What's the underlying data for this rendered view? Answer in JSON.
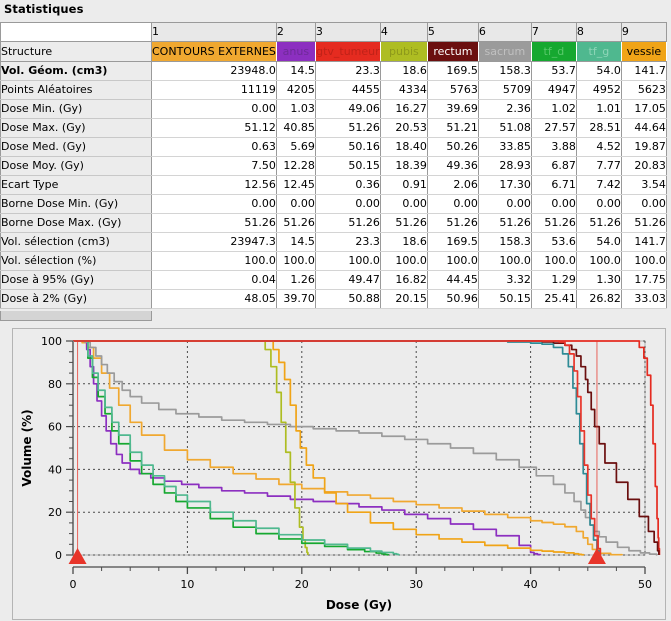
{
  "panel": {
    "title": "Statistiques"
  },
  "table": {
    "column_numbers": [
      "1",
      "2",
      "3",
      "4",
      "5",
      "6",
      "7",
      "8",
      "9"
    ],
    "row_header_label": "Structure",
    "structures": [
      {
        "name": "CONTOURS EXTERNES",
        "color": "#f0a830",
        "text_color": "#000000"
      },
      {
        "name": "anus",
        "color": "#8c2fc0",
        "text_color": "#6f2a99"
      },
      {
        "name": "gtv_tumeur",
        "color": "#e52b20",
        "text_color": "#c02218"
      },
      {
        "name": "pubis",
        "color": "#aebd22",
        "text_color": "#8d991b"
      },
      {
        "name": "rectum",
        "color": "#6b0f0f",
        "text_color": "#ffffff"
      },
      {
        "name": "sacrum",
        "color": "#9b9b9b",
        "text_color": "#c0c0c0"
      },
      {
        "name": "tf_d",
        "color": "#16a830",
        "text_color": "#59c96b"
      },
      {
        "name": "tf_g",
        "color": "#4fb88f",
        "text_color": "#8fd5b8"
      },
      {
        "name": "vessie",
        "color": "#f0a417",
        "text_color": "#000000"
      }
    ],
    "rows": [
      {
        "label": "Vol. Géom. (cm3)",
        "bold": true,
        "values": [
          "23948.0",
          "14.5",
          "23.3",
          "18.6",
          "169.5",
          "158.3",
          "53.7",
          "54.0",
          "141.7"
        ]
      },
      {
        "label": "Points Aléatoires",
        "bold": false,
        "values": [
          "11119",
          "4205",
          "4455",
          "4334",
          "5763",
          "5709",
          "4947",
          "4952",
          "5623"
        ]
      },
      {
        "label": "Dose Min. (Gy)",
        "bold": false,
        "values": [
          "0.00",
          "1.03",
          "49.06",
          "16.27",
          "39.69",
          "2.36",
          "1.02",
          "1.01",
          "17.05"
        ]
      },
      {
        "label": "Dose Max. (Gy)",
        "bold": false,
        "values": [
          "51.12",
          "40.85",
          "51.26",
          "20.53",
          "51.21",
          "51.08",
          "27.57",
          "28.51",
          "44.64"
        ]
      },
      {
        "label": "Dose Med. (Gy)",
        "bold": false,
        "values": [
          "0.63",
          "5.69",
          "50.16",
          "18.40",
          "50.26",
          "33.85",
          "3.88",
          "4.52",
          "19.87"
        ]
      },
      {
        "label": "Dose Moy. (Gy)",
        "bold": false,
        "values": [
          "7.50",
          "12.28",
          "50.15",
          "18.39",
          "49.36",
          "28.93",
          "6.87",
          "7.77",
          "20.83"
        ]
      },
      {
        "label": "Ecart Type",
        "bold": false,
        "values": [
          "12.56",
          "12.45",
          "0.36",
          "0.91",
          "2.06",
          "17.30",
          "6.71",
          "7.42",
          "3.54"
        ]
      },
      {
        "label": "Borne Dose Min. (Gy)",
        "bold": false,
        "values": [
          "0.00",
          "0.00",
          "0.00",
          "0.00",
          "0.00",
          "0.00",
          "0.00",
          "0.00",
          "0.00"
        ]
      },
      {
        "label": "Borne Dose Max. (Gy)",
        "bold": false,
        "values": [
          "51.26",
          "51.26",
          "51.26",
          "51.26",
          "51.26",
          "51.26",
          "51.26",
          "51.26",
          "51.26"
        ]
      },
      {
        "label": "Vol. sélection (cm3)",
        "bold": false,
        "values": [
          "23947.3",
          "14.5",
          "23.3",
          "18.6",
          "169.5",
          "158.3",
          "53.6",
          "54.0",
          "141.7"
        ]
      },
      {
        "label": "Vol. sélection (%)",
        "bold": false,
        "values": [
          "100.0",
          "100.0",
          "100.0",
          "100.0",
          "100.0",
          "100.0",
          "100.0",
          "100.0",
          "100.0"
        ]
      },
      {
        "label": "Dose à 95% (Gy)",
        "bold": false,
        "values": [
          "0.04",
          "1.26",
          "49.47",
          "16.82",
          "44.45",
          "3.32",
          "1.29",
          "1.30",
          "17.75"
        ]
      },
      {
        "label": "Dose à 2% (Gy)",
        "bold": false,
        "values": [
          "48.05",
          "39.70",
          "50.88",
          "20.15",
          "50.96",
          "50.15",
          "25.41",
          "26.82",
          "33.03"
        ]
      }
    ]
  },
  "chart_data": {
    "type": "line",
    "title": "",
    "xlabel": "Dose (Gy)",
    "ylabel": "Volume (%)",
    "xlim": [
      0,
      50
    ],
    "ylim": [
      0,
      100
    ],
    "xticks": [
      0,
      10,
      20,
      30,
      40,
      50
    ],
    "yticks": [
      0,
      20,
      40,
      60,
      80,
      100
    ],
    "grid": true,
    "legend": "none",
    "markers": [
      {
        "name": "cursor-min",
        "x": 0.4,
        "color": "#e8352a"
      },
      {
        "name": "cursor-max",
        "x": 45.8,
        "color": "#e8352a"
      }
    ],
    "series": [
      {
        "name": "CONTOURS EXTERNES",
        "color": "#f0a830",
        "x": [
          0,
          0.4,
          0.8,
          1.2,
          1.8,
          2.5,
          3.2,
          4,
          5,
          6,
          8,
          10,
          12,
          14,
          16,
          18,
          20,
          22,
          24,
          26,
          28,
          30,
          32,
          34,
          36,
          38,
          40,
          41,
          42,
          43,
          44,
          44.6,
          45,
          45.4,
          46,
          47,
          48
        ],
        "y": [
          100,
          100,
          99.2,
          97,
          92,
          85,
          78,
          70,
          62,
          56,
          49,
          44.5,
          41,
          38,
          35.5,
          33,
          31,
          29.5,
          28,
          26.5,
          25,
          23.5,
          22,
          20.5,
          19,
          17.5,
          16,
          15.2,
          14.4,
          13.2,
          11,
          8,
          5,
          2.6,
          0.8,
          0.15,
          0
        ]
      },
      {
        "name": "anus",
        "color": "#8c2fc0",
        "x": [
          0,
          1,
          1.2,
          1.5,
          1.8,
          2.1,
          2.5,
          2.9,
          3.3,
          3.8,
          4.3,
          5,
          5.8,
          6.8,
          8,
          9.5,
          11,
          13,
          15,
          17,
          19,
          21,
          23,
          25,
          27,
          29,
          31,
          33,
          35,
          37,
          39,
          40,
          40.3,
          40.6,
          40.85
        ],
        "y": [
          100,
          100,
          96,
          88,
          80,
          72,
          65,
          58,
          52,
          47,
          43,
          40,
          38,
          36,
          34.5,
          33,
          31.5,
          30,
          29,
          27.5,
          26,
          25,
          24,
          22.5,
          21,
          19,
          17,
          14.5,
          12,
          9,
          4.5,
          1.2,
          0.6,
          0.2,
          0
        ]
      },
      {
        "name": "gtv_tumeur",
        "color": "#e52b20",
        "x": [
          0,
          10,
          20,
          30,
          40,
          45,
          47,
          48.5,
          49.06,
          49.5,
          49.9,
          50.2,
          50.5,
          50.7,
          50.9,
          51.05,
          51.15,
          51.2,
          51.26
        ],
        "y": [
          100,
          100,
          100,
          100,
          100,
          100,
          100,
          100,
          100,
          97,
          92,
          84,
          70,
          52,
          32,
          17,
          8,
          3,
          0
        ]
      },
      {
        "name": "pubis",
        "color": "#aebd22",
        "x": [
          0,
          5,
          10,
          14,
          16,
          16.27,
          16.8,
          17.3,
          17.8,
          18.2,
          18.6,
          19,
          19.4,
          19.8,
          20.1,
          20.3,
          20.45,
          20.53
        ],
        "y": [
          100,
          100,
          100,
          100,
          100,
          100,
          96,
          88,
          76,
          62,
          48,
          34,
          22,
          13,
          7,
          3.5,
          1.2,
          0
        ]
      },
      {
        "name": "rectum",
        "color": "#6b0f0f",
        "x": [
          0,
          10,
          20,
          30,
          35,
          39.69,
          41,
          42,
          43,
          43.6,
          44,
          44.4,
          44.8,
          45,
          45.3,
          45.6,
          46,
          46.5,
          47.5,
          48.5,
          49.5,
          50.3,
          50.8,
          51.1,
          51.21
        ],
        "y": [
          100,
          100,
          100,
          100,
          100,
          100,
          99.6,
          99,
          98,
          96,
          93,
          88,
          82,
          76,
          68,
          60,
          52,
          43,
          34,
          26,
          18,
          11,
          6,
          2,
          0
        ]
      },
      {
        "name": "sacrum",
        "color": "#9b9b9b",
        "x": [
          0,
          1,
          1.5,
          2,
          2.5,
          3,
          3.6,
          4.3,
          5,
          6,
          7.5,
          9,
          11,
          13,
          15,
          17,
          19,
          21,
          23,
          25,
          27,
          29,
          31,
          33,
          35,
          37,
          39,
          40.5,
          42,
          43,
          43.8,
          44.4,
          44.8,
          45.2,
          45.6,
          46,
          46.6,
          47.6,
          48.6,
          49.6,
          50.4,
          51,
          51.08
        ],
        "y": [
          100,
          99.5,
          97,
          93,
          89,
          85,
          81,
          77,
          74,
          71,
          68,
          66,
          64.5,
          63,
          62,
          61,
          60,
          59,
          58,
          57,
          55.5,
          54,
          52,
          50,
          47.5,
          44.5,
          41,
          37,
          33,
          29,
          25,
          21,
          17.5,
          14,
          11,
          8.5,
          6,
          3.6,
          2,
          1,
          0.4,
          0.1,
          0
        ]
      },
      {
        "name": "tf_d",
        "color": "#16a830",
        "x": [
          0,
          1.02,
          1.3,
          1.7,
          2.2,
          2.8,
          3.4,
          4,
          5,
          6,
          7,
          8,
          9,
          10,
          12,
          14,
          16,
          18,
          20,
          22,
          24,
          25.5,
          26.5,
          27,
          27.3,
          27.45,
          27.57
        ],
        "y": [
          100,
          100,
          92,
          83,
          74,
          66,
          58,
          52,
          44,
          38,
          33,
          29,
          25,
          22,
          17,
          13,
          10,
          7.5,
          5.5,
          4,
          2.5,
          1.6,
          0.9,
          0.5,
          0.25,
          0.1,
          0
        ]
      },
      {
        "name": "tf_g",
        "color": "#4fb88f",
        "x": [
          0,
          1.01,
          1.3,
          1.7,
          2.2,
          2.8,
          3.4,
          4,
          5,
          6,
          7,
          8,
          9,
          10,
          12,
          14,
          16,
          18,
          20,
          22,
          24,
          26,
          27,
          28,
          28.3,
          28.45,
          28.51
        ],
        "y": [
          100,
          100,
          93,
          85,
          77,
          69,
          62,
          56,
          48,
          42,
          37,
          32,
          28,
          25,
          20,
          16,
          12.5,
          9.5,
          7,
          5,
          3.2,
          1.8,
          1.2,
          0.6,
          0.3,
          0.1,
          0
        ]
      },
      {
        "name": "vessie",
        "color": "#f0a417",
        "x": [
          0,
          10,
          17.05,
          17.5,
          18,
          18.5,
          19,
          19.5,
          19.87,
          20.4,
          21,
          22,
          23,
          24,
          26,
          28,
          30,
          32,
          34,
          36,
          38,
          40,
          41,
          42,
          43,
          43.8,
          44.2,
          44.45,
          44.64
        ],
        "y": [
          100,
          100,
          100,
          96,
          90,
          82,
          70,
          58,
          50,
          42,
          36,
          29,
          24,
          20,
          15,
          12,
          9.5,
          7.5,
          6,
          4.5,
          3.2,
          2.2,
          1.8,
          1.4,
          1,
          0.6,
          0.3,
          0.1,
          0
        ]
      }
    ],
    "dvh_display_series": [
      {
        "name": "teal-overlay",
        "color": "#2e8b96",
        "x": [
          0,
          20,
          30,
          35,
          38,
          40,
          41,
          42,
          42.8,
          43.3,
          43.7,
          44,
          44.3,
          44.6,
          44.9,
          45.2,
          45.5,
          45.8,
          46
        ],
        "y": [
          100,
          100,
          100,
          100,
          99.5,
          99,
          98.5,
          97,
          94,
          88,
          78,
          66,
          52,
          38,
          24,
          14,
          7,
          2,
          0
        ]
      },
      {
        "name": "red-overlay",
        "color": "#e8352a",
        "x": [
          0,
          20,
          30,
          38,
          41,
          42.5,
          43,
          43.4,
          43.8,
          44.1,
          44.4,
          44.7,
          45,
          45.3,
          45.6,
          45.9,
          46.1
        ],
        "y": [
          100,
          100,
          100,
          100,
          100,
          99.5,
          98,
          94,
          86,
          74,
          58,
          42,
          28,
          17,
          9,
          3,
          0
        ]
      }
    ]
  }
}
